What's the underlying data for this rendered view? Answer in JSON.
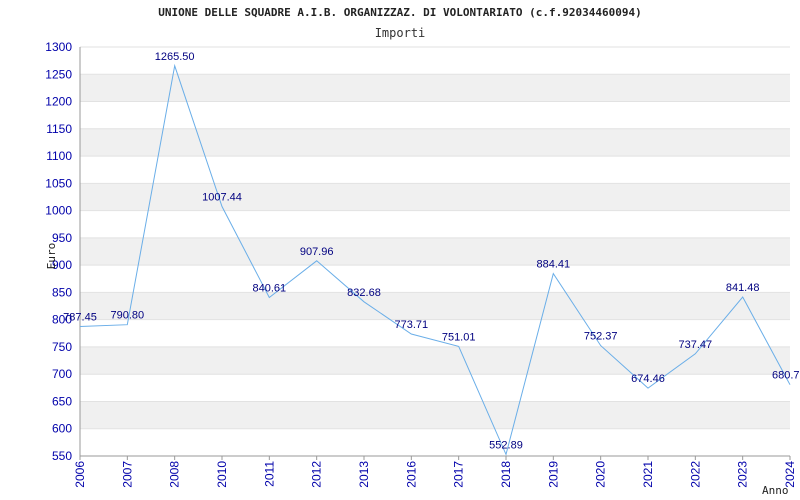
{
  "chart_data": {
    "type": "line",
    "title": "UNIONE DELLE SQUADRE A.I.B. ORGANIZZAZ. DI VOLONTARIATO (c.f.92034460094)",
    "subtitle": "Importi",
    "xlabel": "Anno",
    "ylabel": "Euro",
    "categories": [
      "2006",
      "2007",
      "2008",
      "2010",
      "2011",
      "2012",
      "2013",
      "2016",
      "2017",
      "2018",
      "2019",
      "2020",
      "2021",
      "2022",
      "2023",
      "2024"
    ],
    "values": [
      787.45,
      790.8,
      1265.5,
      1007.44,
      840.61,
      907.96,
      832.68,
      773.71,
      751.01,
      552.89,
      884.41,
      752.37,
      674.46,
      737.47,
      841.48,
      680.7
    ],
    "labels": [
      "787.45",
      "790.80",
      "1265.50",
      "1007.44",
      "840.61",
      "907.96",
      "832.68",
      "773.71",
      "751.01",
      "552.89",
      "884.41",
      "752.37",
      "674.46",
      "737.47",
      "841.48",
      "680.7"
    ],
    "yticks": [
      550,
      600,
      650,
      700,
      750,
      800,
      850,
      900,
      950,
      1000,
      1050,
      1100,
      1150,
      1200,
      1250,
      1300
    ],
    "ylim": [
      550,
      1300
    ],
    "grid": true,
    "colors": {
      "line": "#6aaee8",
      "band": "#f0f0f0",
      "tick_text": "#0000aa",
      "label_text": "#000080"
    }
  }
}
